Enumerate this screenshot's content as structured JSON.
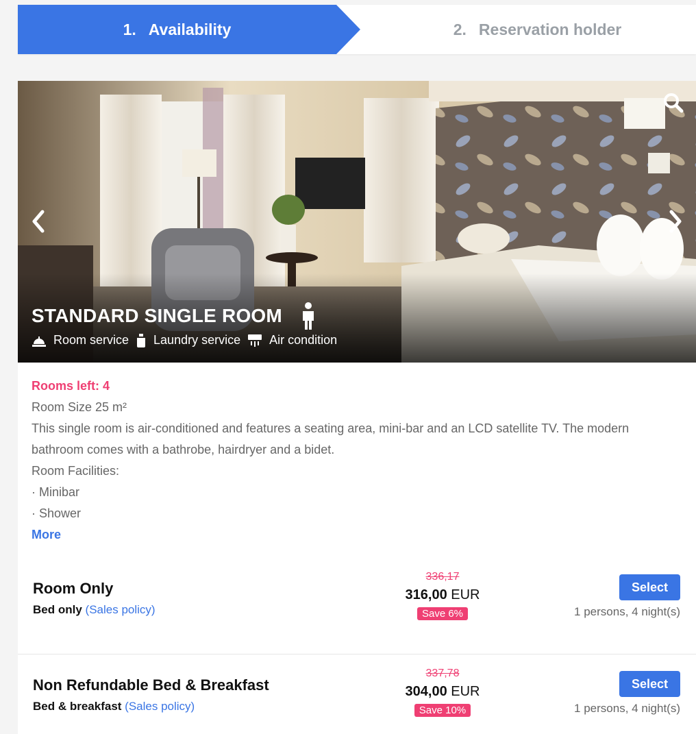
{
  "stepper": {
    "steps": [
      {
        "number": "1.",
        "label": "Availability",
        "active": true
      },
      {
        "number": "2.",
        "label": "Reservation holder",
        "active": false
      }
    ]
  },
  "room": {
    "title": "STANDARD SINGLE ROOM",
    "amenities": [
      "Room service",
      "Laundry service",
      "Air condition"
    ],
    "rooms_left": "Rooms left: 4",
    "size": "Room Size 25 m²",
    "description": "This single room is air-conditioned and features a seating area, mini-bar and an LCD satellite TV. The modern bathroom comes with a bathrobe, hairdryer and a bidet.",
    "facilities_heading": "Room Facilities:",
    "facilities": [
      "· Minibar",
      "· Shower"
    ],
    "more_label": "More"
  },
  "rates": [
    {
      "name": "Room Only",
      "board": "Bed only",
      "policy_label": "(Sales policy)",
      "old_price": "336,17",
      "price": "316,00",
      "currency": "EUR",
      "save": "Save 6%",
      "select_label": "Select",
      "occupancy": "1 persons, 4 night(s)"
    },
    {
      "name": "Non Refundable Bed & Breakfast",
      "board": "Bed & breakfast",
      "policy_label": "(Sales policy)",
      "old_price": "337,78",
      "price": "304,00",
      "currency": "EUR",
      "save": "Save 10%",
      "select_label": "Select",
      "occupancy": "1 persons, 4 night(s)"
    }
  ],
  "icons": {
    "prev": "chevron-left-icon",
    "next": "chevron-right-icon",
    "zoom": "search-icon",
    "person": "person-icon",
    "room_service": "service-bell-icon",
    "laundry": "laundry-bag-icon",
    "air": "air-conditioner-icon"
  },
  "colors": {
    "accent": "#3a75e4",
    "highlight": "#ef3f73"
  }
}
